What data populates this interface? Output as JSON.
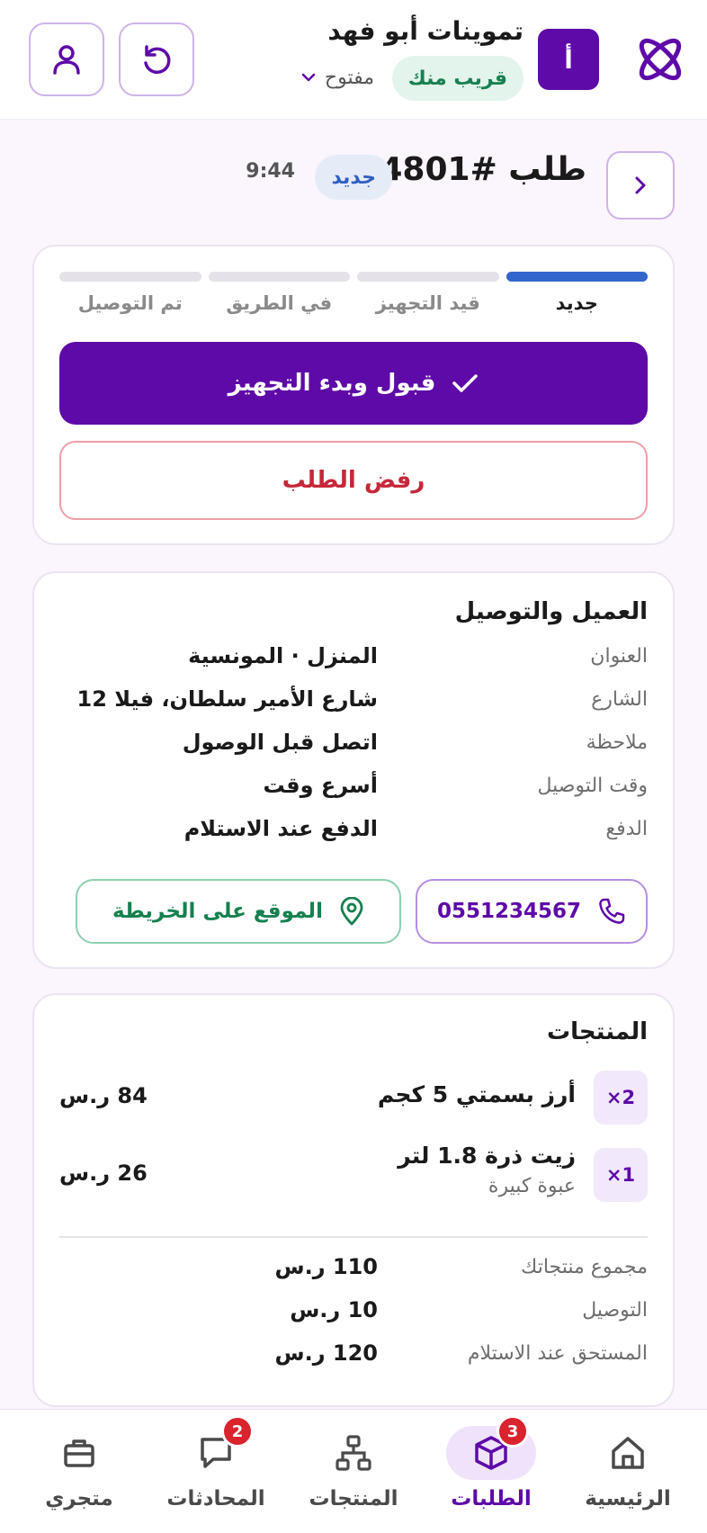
{
  "header": {
    "avatar_letter": "أ",
    "store_name": "تموينات أبو فهد",
    "near_badge": "قريب منك",
    "status_label": "مفتوح"
  },
  "order": {
    "title": "طلب #4801",
    "status_badge": "جديد",
    "time": "9:44"
  },
  "progress": {
    "steps": [
      "جديد",
      "قيد التجهيز",
      "في الطريق",
      "تم التوصيل"
    ],
    "active_index": 0
  },
  "actions": {
    "accept_label": "قبول وبدء التجهيز",
    "reject_label": "رفض الطلب"
  },
  "customer": {
    "title": "العميل والتوصيل",
    "rows": [
      {
        "label": "العنوان",
        "value": "المنزل · المونسية"
      },
      {
        "label": "الشارع",
        "value": "شارع الأمير سلطان، فيلا 12"
      },
      {
        "label": "ملاحظة",
        "value": "اتصل قبل الوصول"
      },
      {
        "label": "وقت التوصيل",
        "value": "أسرع وقت"
      },
      {
        "label": "الدفع",
        "value": "الدفع عند الاستلام"
      }
    ],
    "phone": "0551234567",
    "map_label": "الموقع على الخريطة"
  },
  "products": {
    "title": "المنتجات",
    "items": [
      {
        "qty": "2×",
        "name": "أرز بسمتي 5 كجم",
        "variant": "",
        "price": "84 ر.س"
      },
      {
        "qty": "1×",
        "name": "زيت ذرة 1.8 لتر",
        "variant": "عبوة كبيرة",
        "price": "26 ر.س"
      }
    ],
    "summary": [
      {
        "label": "مجموع منتجاتك",
        "value": "110 ر.س"
      },
      {
        "label": "التوصيل",
        "value": "10 ر.س"
      },
      {
        "label": "المستحق عند الاستلام",
        "value": "120 ر.س"
      }
    ]
  },
  "nav": {
    "items": [
      {
        "label": "الرئيسية",
        "icon": "home-icon",
        "badge": ""
      },
      {
        "label": "الطلبات",
        "icon": "box-icon",
        "badge": "3",
        "active": true
      },
      {
        "label": "المنتجات",
        "icon": "hierarchy-icon",
        "badge": ""
      },
      {
        "label": "المحادثات",
        "icon": "chat-icon",
        "badge": "2"
      },
      {
        "label": "متجري",
        "icon": "briefcase-icon",
        "badge": ""
      }
    ]
  },
  "colors": {
    "primary": "#5e0aa8",
    "accent_blue": "#3366cc",
    "success": "#17804f",
    "danger": "#c5283a",
    "badge_red": "#d9232d"
  }
}
